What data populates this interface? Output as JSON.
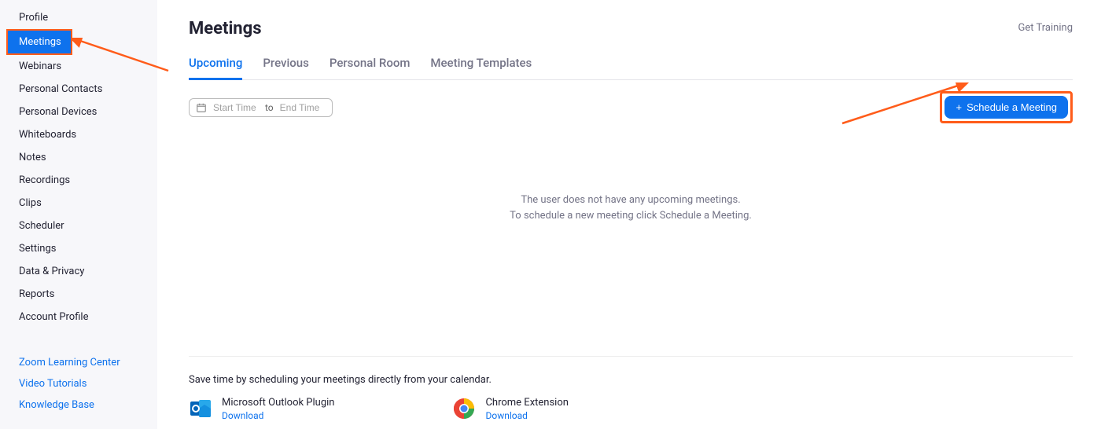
{
  "sidebar": {
    "items": [
      {
        "label": "Profile"
      },
      {
        "label": "Meetings",
        "active": true
      },
      {
        "label": "Webinars"
      },
      {
        "label": "Personal Contacts"
      },
      {
        "label": "Personal Devices"
      },
      {
        "label": "Whiteboards"
      },
      {
        "label": "Notes"
      },
      {
        "label": "Recordings"
      },
      {
        "label": "Clips"
      },
      {
        "label": "Scheduler"
      },
      {
        "label": "Settings"
      },
      {
        "label": "Data & Privacy"
      },
      {
        "label": "Reports"
      },
      {
        "label": "Account Profile"
      }
    ],
    "links": [
      {
        "label": "Zoom Learning Center"
      },
      {
        "label": "Video Tutorials"
      },
      {
        "label": "Knowledge Base"
      }
    ]
  },
  "main": {
    "title": "Meetings",
    "get_training": "Get Training",
    "tabs": [
      {
        "label": "Upcoming",
        "active": true
      },
      {
        "label": "Previous"
      },
      {
        "label": "Personal Room"
      },
      {
        "label": "Meeting Templates"
      }
    ],
    "date_range": {
      "start_placeholder": "Start Time",
      "to_label": "to",
      "end_placeholder": "End Time"
    },
    "schedule_button": "Schedule a Meeting",
    "empty": {
      "line1": "The user does not have any upcoming meetings.",
      "line2": "To schedule a new meeting click Schedule a Meeting."
    }
  },
  "footer": {
    "heading": "Save time by scheduling your meetings directly from your calendar.",
    "plugins": [
      {
        "name": "Microsoft Outlook Plugin",
        "download": "Download"
      },
      {
        "name": "Chrome Extension",
        "download": "Download"
      }
    ]
  }
}
